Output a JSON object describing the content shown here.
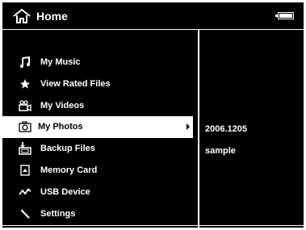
{
  "header": {
    "title": "Home",
    "home_icon": "home-icon",
    "battery_icon": "battery-icon"
  },
  "menu": {
    "items": [
      {
        "label": "My Music",
        "icon": "music-note-icon",
        "selected": false
      },
      {
        "label": "View Rated Files",
        "icon": "star-icon",
        "selected": false
      },
      {
        "label": "My Videos",
        "icon": "video-camera-icon",
        "selected": false
      },
      {
        "label": "My Photos",
        "icon": "camera-icon",
        "selected": true
      },
      {
        "label": "Backup Files",
        "icon": "backup-icon",
        "selected": false
      },
      {
        "label": "Memory Card",
        "icon": "memory-card-icon",
        "selected": false
      },
      {
        "label": "USB Device",
        "icon": "usb-icon",
        "selected": false
      },
      {
        "label": "Settings",
        "icon": "wrench-icon",
        "selected": false
      }
    ]
  },
  "detail": {
    "date": "2006.1205",
    "name": "sample"
  },
  "colors": {
    "background": "#000000",
    "foreground": "#ffffff",
    "selection": "#ffffff"
  }
}
